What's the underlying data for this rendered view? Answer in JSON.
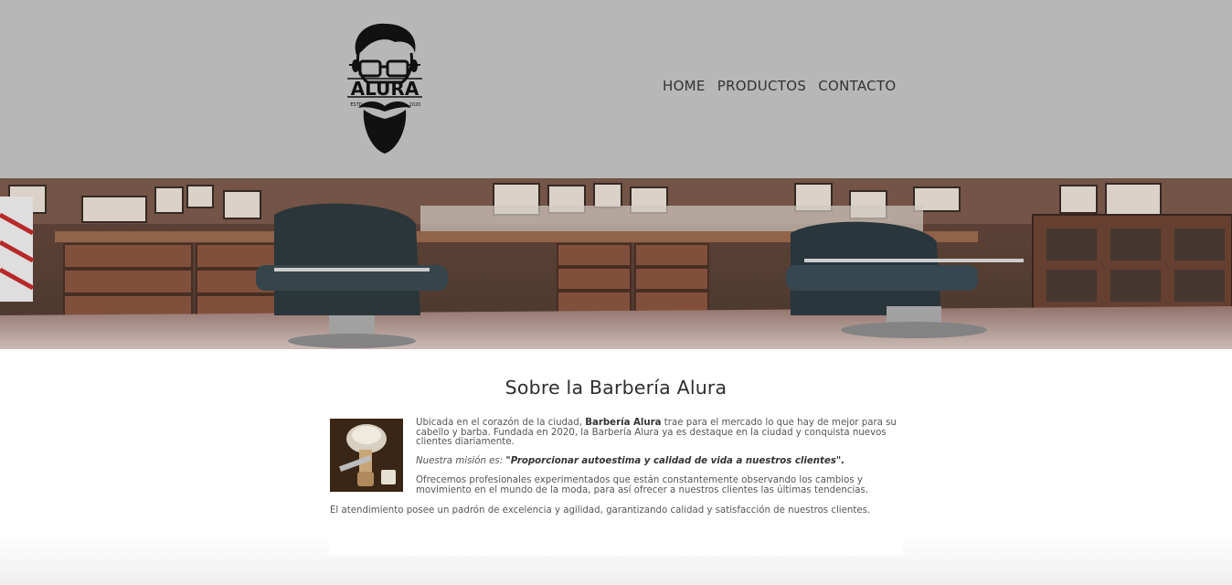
{
  "header": {
    "logo_text": "ALURA",
    "logo_estd": "ESTD",
    "logo_year": "2020",
    "nav": [
      {
        "label": "HOME"
      },
      {
        "label": "PRODUCTOS"
      },
      {
        "label": "CONTACTO"
      }
    ]
  },
  "main": {
    "title": "Sobre la Barbería Alura",
    "p1_before": "Ubicada en el corazón de la ciudad, ",
    "p1_bold": "Barbería Alura",
    "p1_after": " trae para el mercado lo que hay de mejor para su cabello y barba. Fundada en 2020, la Barbería Alura ya es destaque en la ciudad y conquista nuevos clientes diariamente.",
    "p2_before": "Nuestra misión es: ",
    "p2_bold": "\"Proporcionar autoestima y calidad de vida a nuestros clientes\".",
    "p3": "Ofrecemos profesionales experimentados que están constantemente observando los cambios y movimiento en el mundo de la moda, para así ofrecer a nuestros clientes las últimas tendencias.",
    "p4": "El atendimiento posee un padrón de excelencia y agilidad, garantizando calidad y satisfacción de nuestros clientes."
  },
  "colors": {
    "header_bg": "#b7b7b7",
    "text": "#555555",
    "title": "#2d2d2d"
  }
}
